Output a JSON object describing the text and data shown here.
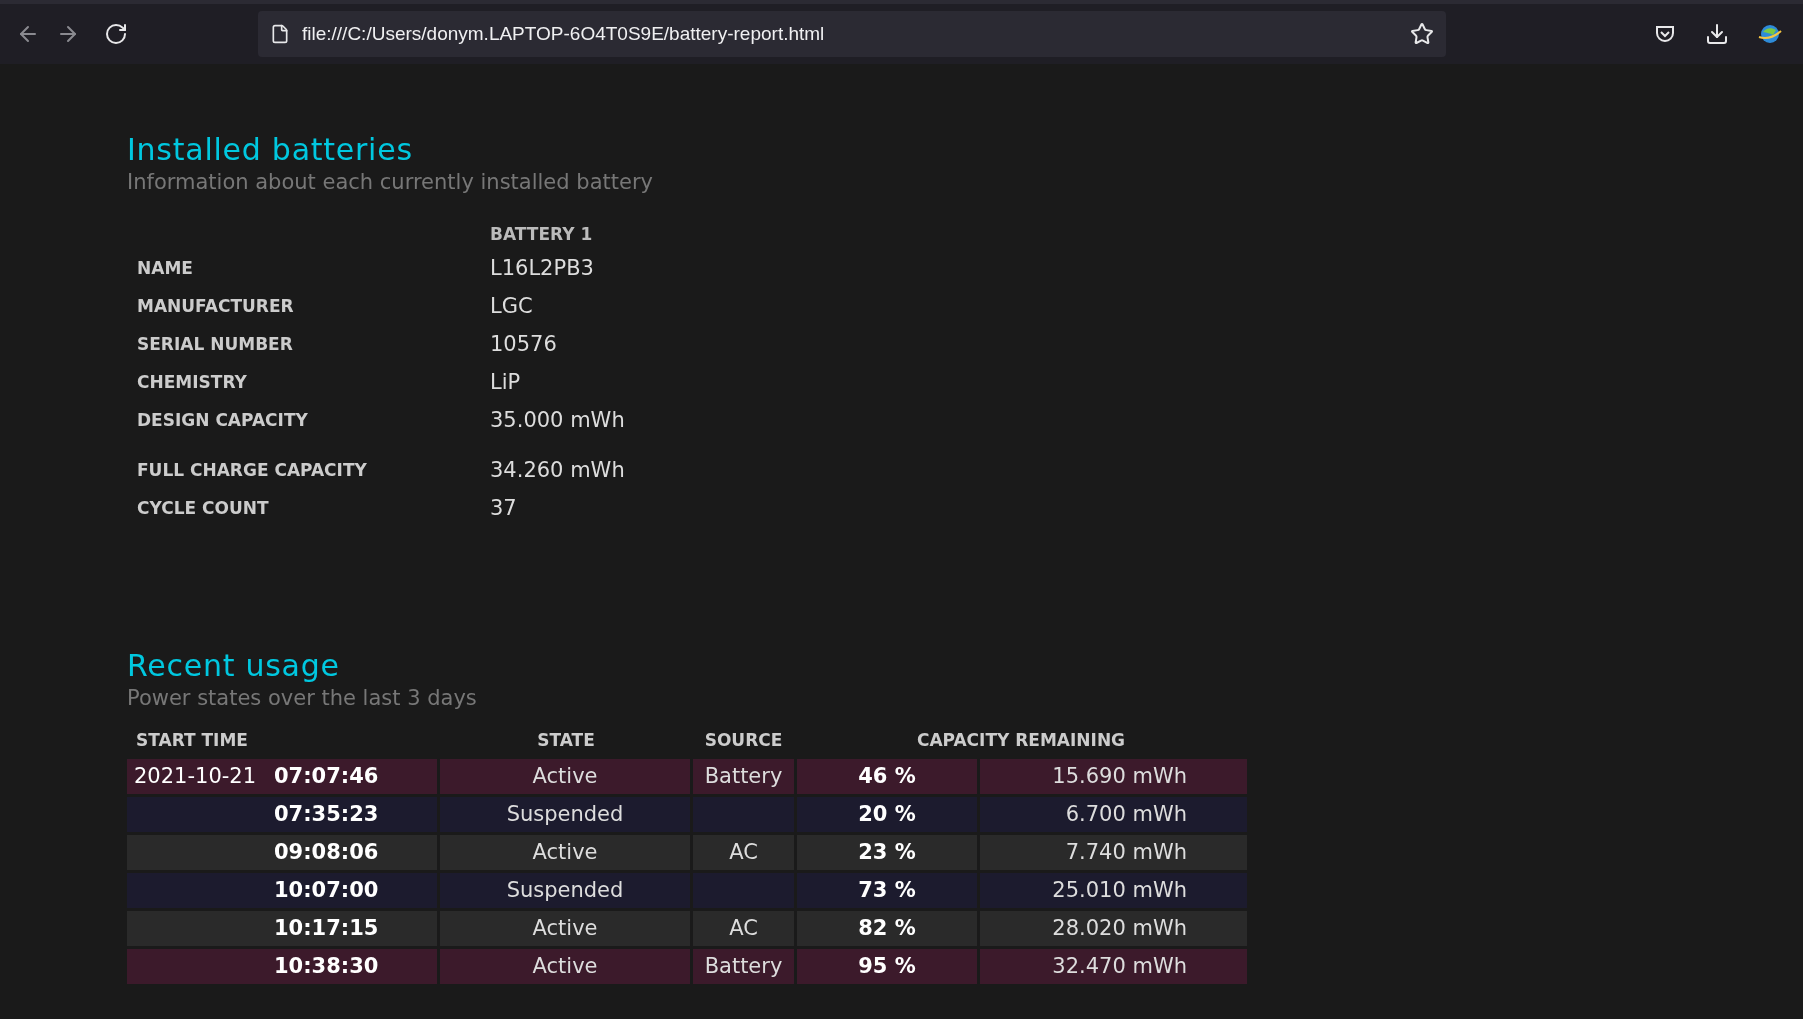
{
  "browser": {
    "url": "file:///C:/Users/donym.LAPTOP-6O4T0S9E/battery-report.html"
  },
  "installed": {
    "title": "Installed batteries",
    "subtitle": "Information about each currently installed battery",
    "column_header": "BATTERY 1",
    "rows": [
      {
        "label": "NAME",
        "value": "L16L2PB3"
      },
      {
        "label": "MANUFACTURER",
        "value": "LGC"
      },
      {
        "label": "SERIAL NUMBER",
        "value": "10576"
      },
      {
        "label": "CHEMISTRY",
        "value": "LiP"
      },
      {
        "label": "DESIGN CAPACITY",
        "value": "35.000 mWh"
      },
      {
        "label": "FULL CHARGE CAPACITY",
        "value": "34.260 mWh"
      },
      {
        "label": "CYCLE COUNT",
        "value": "37"
      }
    ]
  },
  "recent": {
    "title": "Recent usage",
    "subtitle": "Power states over the last 3 days",
    "columns": [
      "START TIME",
      "STATE",
      "SOURCE",
      "CAPACITY REMAINING"
    ],
    "rows": [
      {
        "date": "2021-10-21",
        "time": "07:07:46",
        "state": "Active",
        "source": "Battery",
        "percent": "46 %",
        "capacity": "15.690 mWh",
        "color": "#3c1a2b"
      },
      {
        "time": "07:35:23",
        "state": "Suspended",
        "percent": "20 %",
        "capacity": "6.700 mWh",
        "color": "#1c1b2e"
      },
      {
        "time": "09:08:06",
        "state": "Active",
        "source": "AC",
        "percent": "23 %",
        "capacity": "7.740 mWh",
        "color": "#2a2a2a"
      },
      {
        "time": "10:07:00",
        "state": "Suspended",
        "percent": "73 %",
        "capacity": "25.010 mWh",
        "color": "#1c1b2e"
      },
      {
        "time": "10:17:15",
        "state": "Active",
        "source": "AC",
        "percent": "82 %",
        "capacity": "28.020 mWh",
        "color": "#2a2a2a"
      },
      {
        "time": "10:38:30",
        "state": "Active",
        "source": "Battery",
        "percent": "95 %",
        "capacity": "32.470 mWh",
        "color": "#3c1a2b"
      }
    ]
  }
}
